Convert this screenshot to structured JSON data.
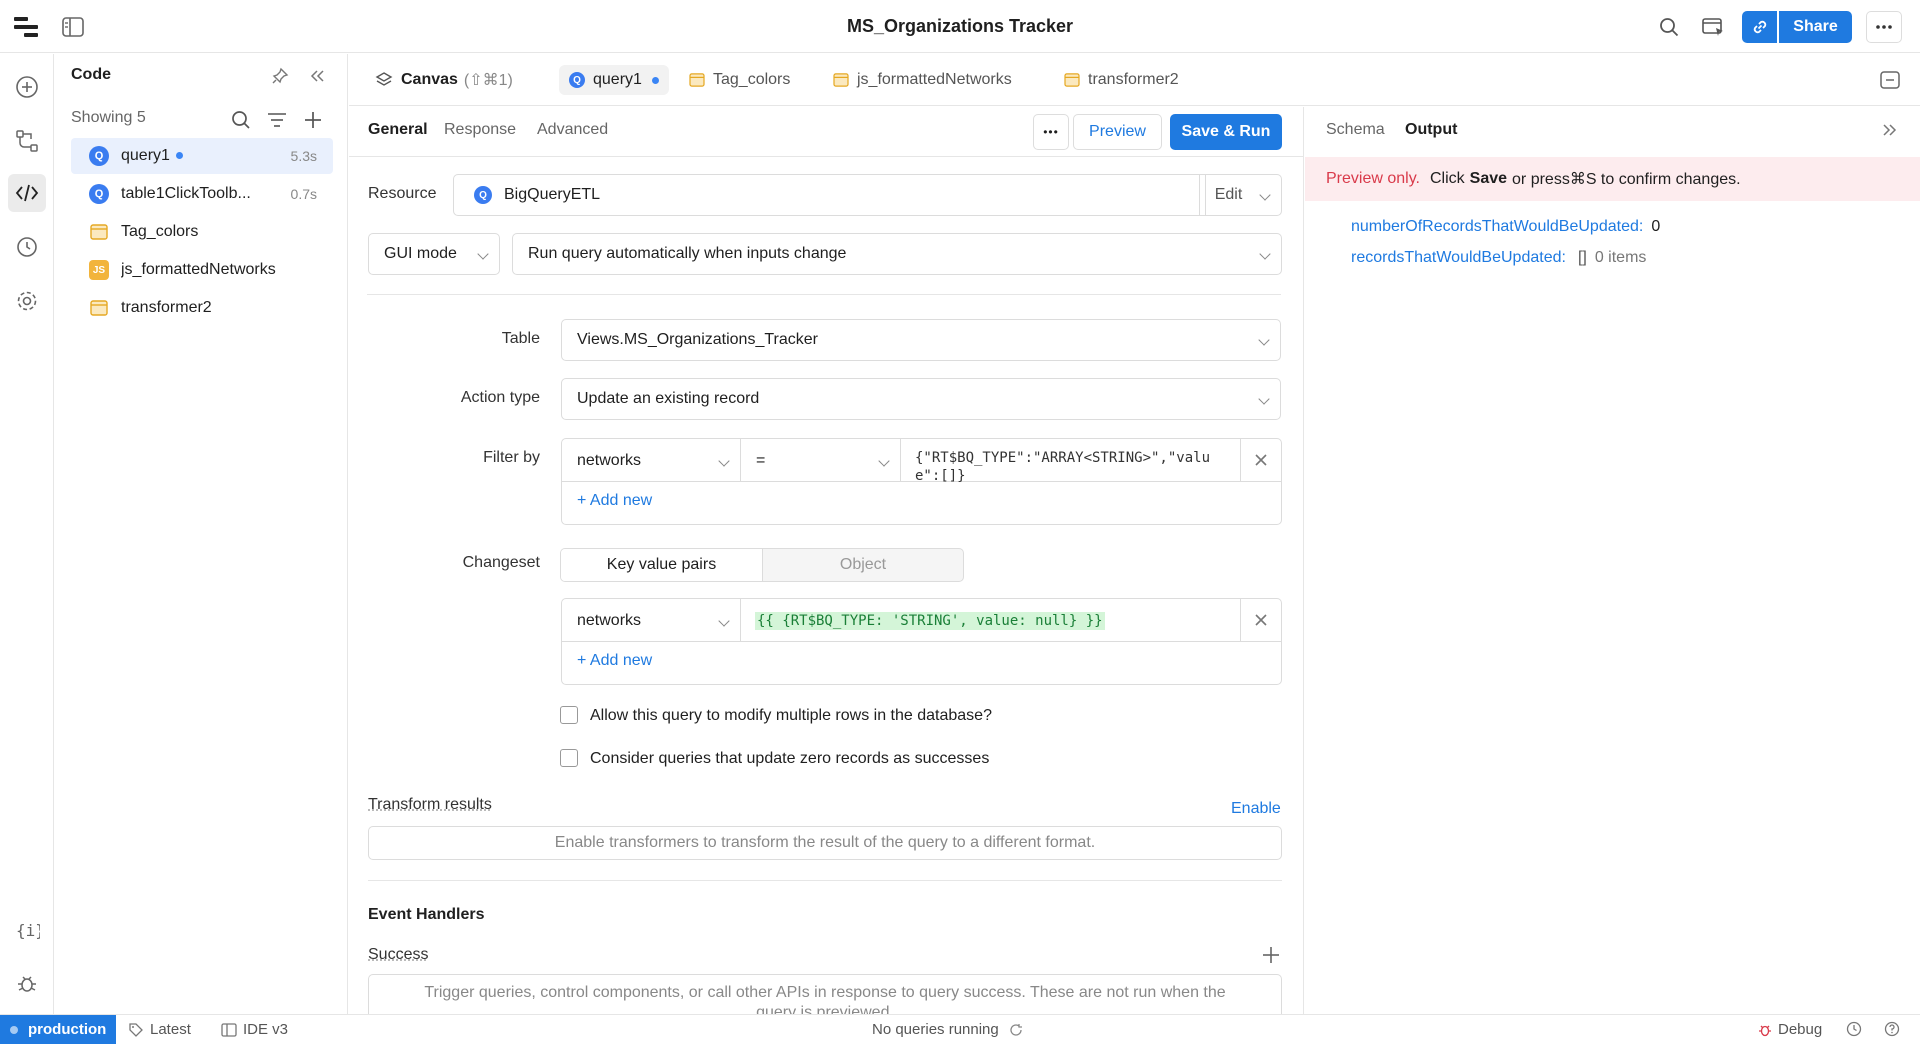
{
  "app": {
    "title": "MS_Organizations Tracker",
    "share_label": "Share"
  },
  "code_panel": {
    "title": "Code",
    "showing": "Showing 5",
    "items": [
      {
        "label": "query1",
        "time": "5.3s",
        "icon": "query-icon"
      },
      {
        "label": "table1ClickToolb...",
        "time": "0.7s",
        "icon": "query-icon"
      },
      {
        "label": "Tag_colors",
        "time": "",
        "icon": "variable-icon"
      },
      {
        "label": "js_formattedNetworks",
        "time": "",
        "icon": "js-icon"
      },
      {
        "label": "transformer2",
        "time": "",
        "icon": "transformer-icon"
      }
    ]
  },
  "tabs": {
    "canvas": "Canvas",
    "canvas_shortcut": "(⇧⌘1)",
    "items": [
      "query1",
      "Tag_colors",
      "js_formattedNetworks",
      "transformer2"
    ]
  },
  "query": {
    "subtabs": [
      "General",
      "Response",
      "Advanced"
    ],
    "more_label": "•••",
    "preview_label": "Preview",
    "save_run_label": "Save & Run",
    "resource_label": "Resource",
    "resource_value": "BigQueryETL",
    "edit_label": "Edit",
    "mode_value": "GUI mode",
    "run_mode_value": "Run query automatically when inputs change",
    "table_label": "Table",
    "table_value": "Views.MS_Organizations_Tracker",
    "action_label": "Action type",
    "action_value": "Update an existing record",
    "filter_label": "Filter by",
    "filter_column": "networks",
    "filter_op": "=",
    "filter_value_line1": "{\"RT$BQ_TYPE\":\"ARRAY<STRING>\",\"valu",
    "filter_value_line2": "e\":[]}",
    "add_new": "+ Add new",
    "changeset_label": "Changeset",
    "changeset_tab_kv": "Key value pairs",
    "changeset_tab_obj": "Object",
    "changeset_key": "networks",
    "changeset_value": "{{ {RT$BQ_TYPE: 'STRING', value: null} }}",
    "allow_multi": "Allow this query to modify multiple rows in the database?",
    "zero_success": "Consider queries that update zero records as successes",
    "transform_label": "Transform results",
    "transform_enable": "Enable",
    "transform_placeholder": "Enable transformers to transform the result of the query to a different format.",
    "event_handlers": "Event Handlers",
    "success_label": "Success",
    "success_placeholder_1": "Trigger queries, control components, or call other APIs in response to query success. These are not run when the",
    "success_placeholder_2": "query is previewed."
  },
  "output": {
    "tabs": [
      "Schema",
      "Output"
    ],
    "notice_prefix": "Preview only.",
    "notice_a": "Click",
    "notice_save": "Save",
    "notice_b": "or press⌘S to confirm changes.",
    "rows": [
      {
        "key": "numberOfRecordsThatWouldBeUpdated:",
        "value": "0"
      },
      {
        "key": "recordsThatWouldBeUpdated:",
        "value": "[]",
        "extra": "0 items"
      }
    ]
  },
  "statusbar": {
    "env": "production",
    "latest": "Latest",
    "ide": "IDE v3",
    "running": "No queries running",
    "debug": "Debug"
  },
  "colors": {
    "accent": "#1f7ae0",
    "notice_bg": "#fdecee",
    "notice_text": "#d93a4a",
    "code_green": "#1a7f37"
  }
}
